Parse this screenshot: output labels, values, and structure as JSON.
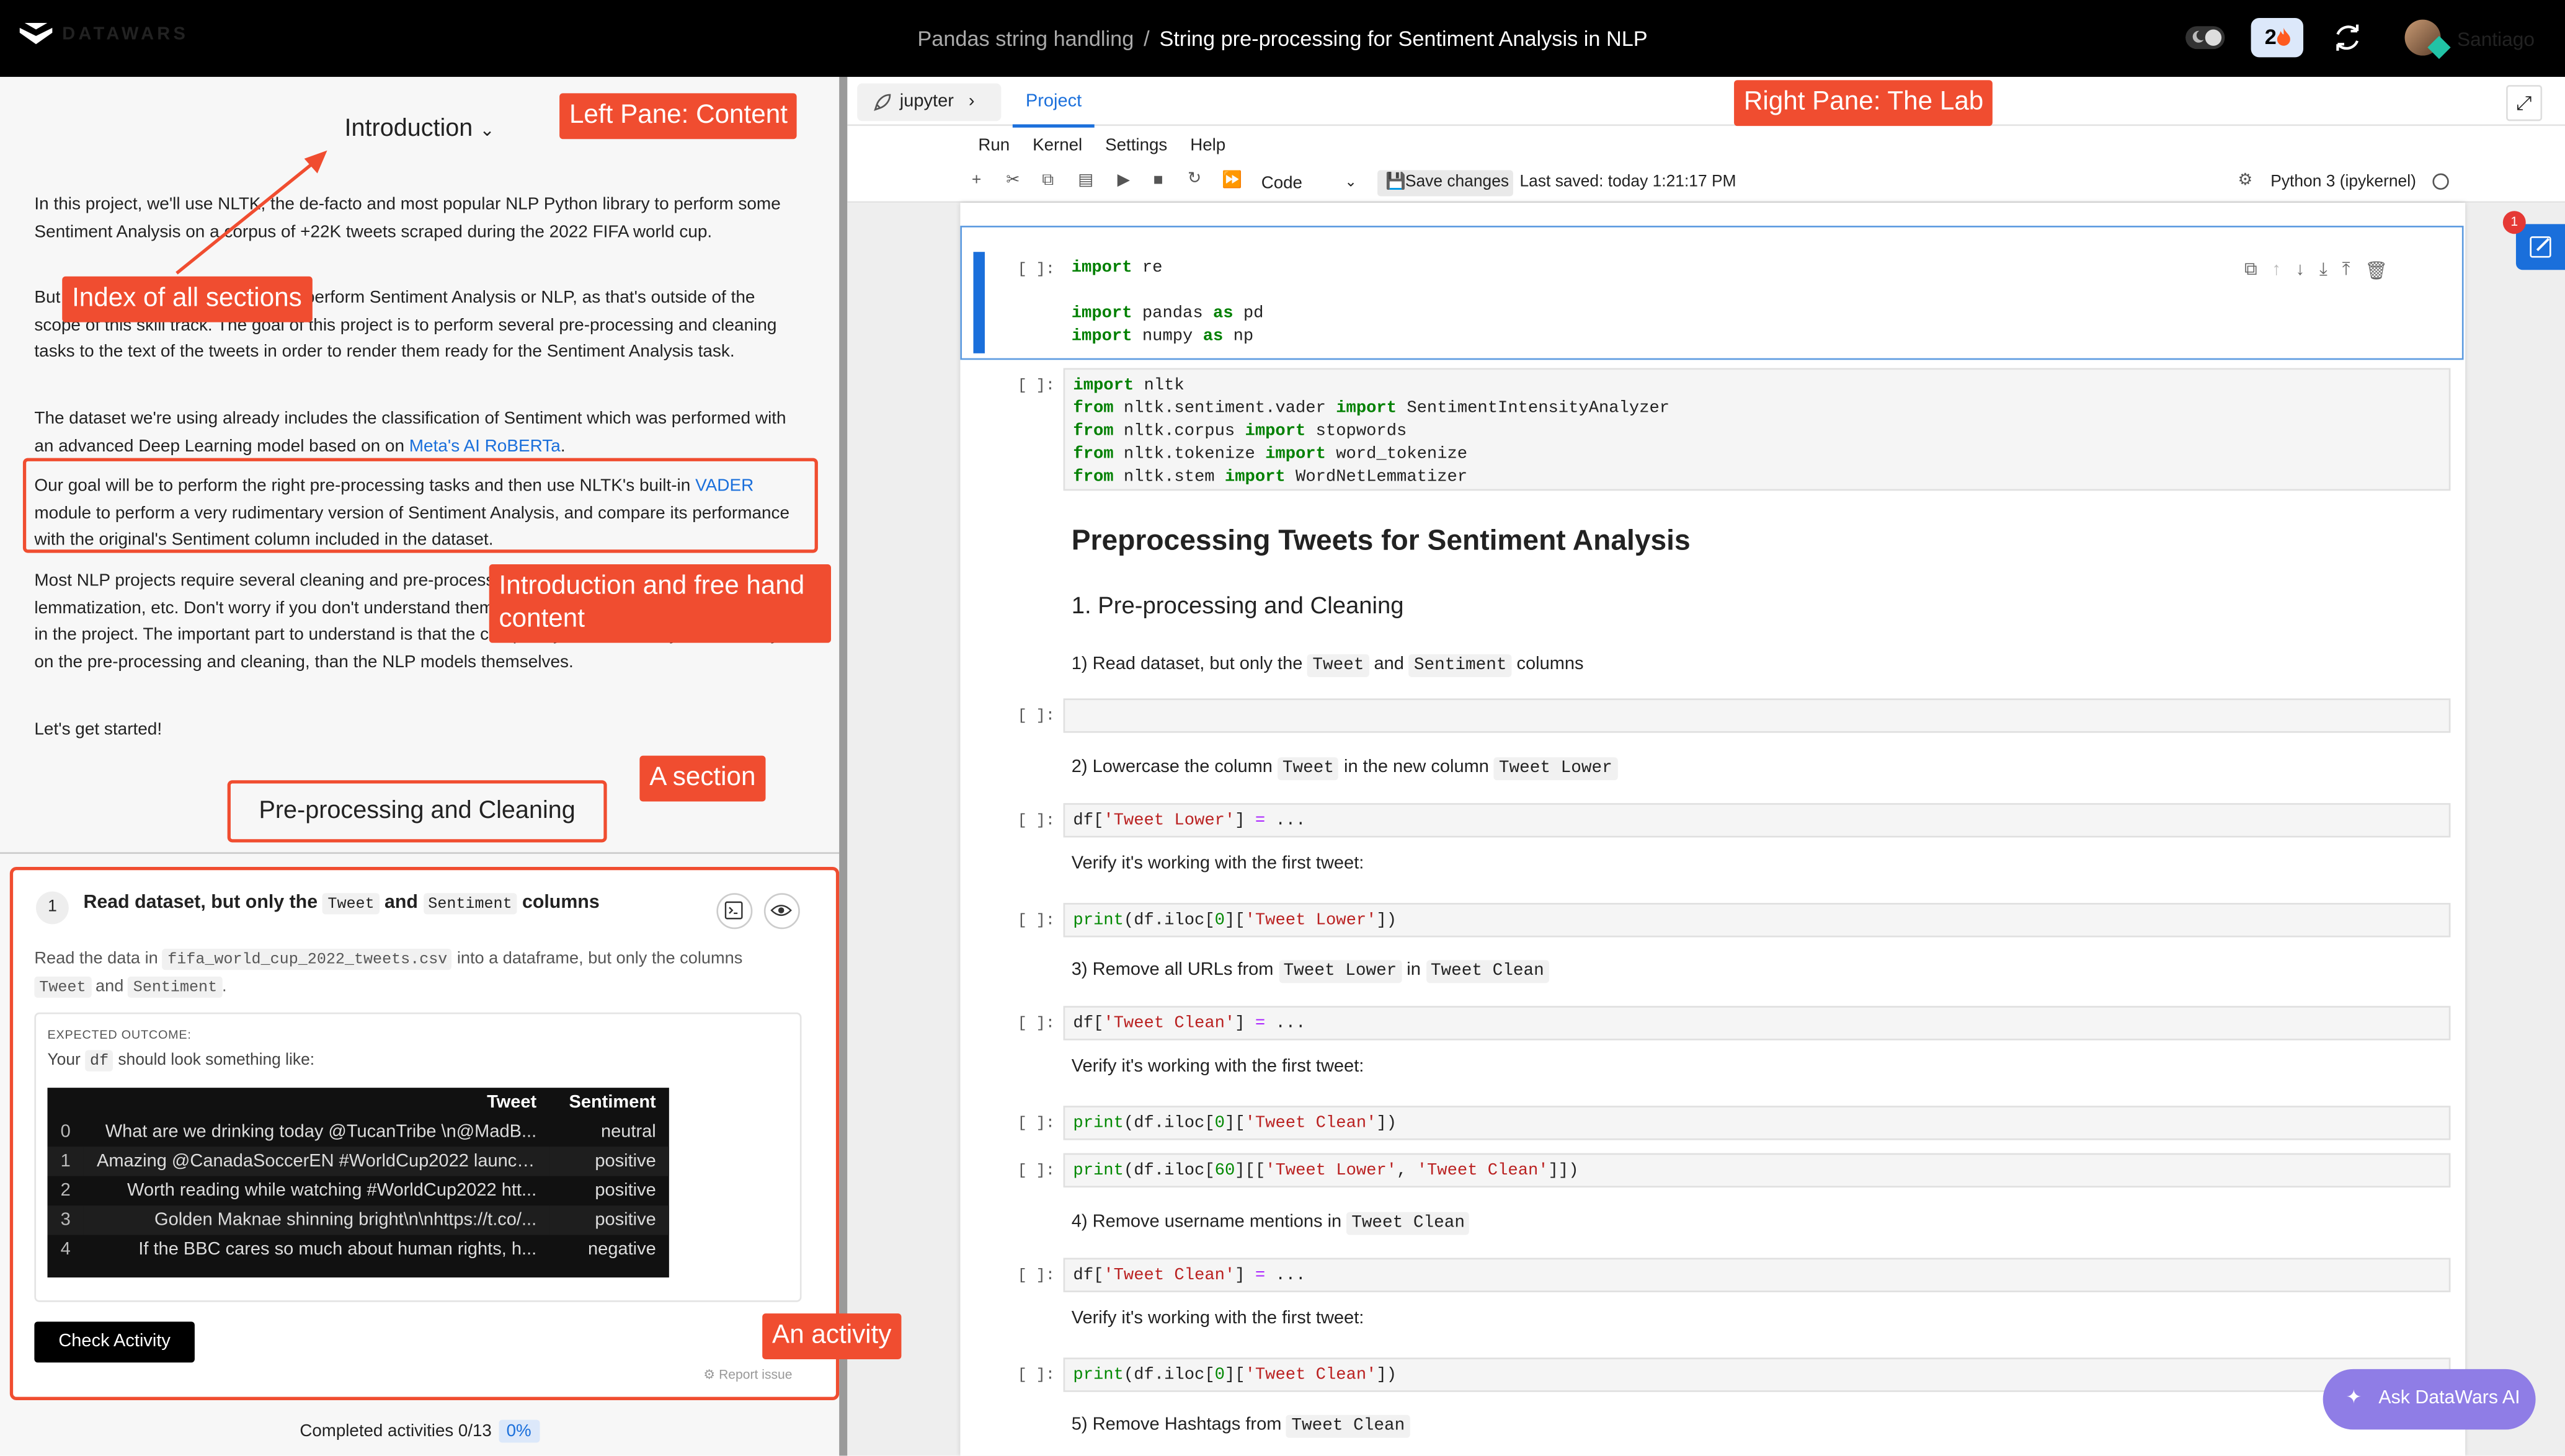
{
  "topbar": {
    "brand": "DATAWARS",
    "breadcrumb_parent": "Pandas string handling",
    "breadcrumb_sep": "/",
    "breadcrumb_current": "String pre-processing for Sentiment Analysis in NLP",
    "streak_count": "2",
    "streak_icon": "flame-icon",
    "user_name": "Santiago"
  },
  "left": {
    "intro_title": "Introduction",
    "p1": "In this project, we'll use NLTK, the de-facto and most popular NLP Python library to perform some Sentiment Analysis on a corpus of +22K tweets scraped during the 2022 FIFA world cup.",
    "p2": "But the goal of this project is not to perform Sentiment Analysis or NLP, as that's outside of the scope of this skill track. The goal of this project is to perform several pre-processing and cleaning tasks to the text of the tweets in order to render them ready for the Sentiment Analysis task.",
    "p3_text": "The dataset we're using already includes the classification of Sentiment which was performed with an advanced Deep Learning model based on on ",
    "p3_link": "Meta's AI RoBERTa",
    "p3_end": ".",
    "p4_a": "Our goal will be to perform the right pre-processing tasks and then use NLTK's built-in ",
    "p4_link": "VADER",
    "p4_b": " module to perform a very rudimentary version of Sentiment Analysis, and compare its performance with the original's Sentiment column included in the dataset.",
    "p5": "Most NLP projects require several cleaning and pre-processing tasks: tokenization, stemming, lemmatization, etc. Don't worry if you don't understand them, we'll explain them as they're required in the project. The important part to understand is that the complexity of NLP usually relies mostly on the pre-processing and cleaning, than the NLP models themselves.",
    "p6": "Let's get started!",
    "section_title": "Pre-processing and Cleaning",
    "activity": {
      "number": "1",
      "title_a": "Read dataset, but only the ",
      "title_c1": "Tweet",
      "title_b": " and ",
      "title_c2": "Sentiment",
      "title_d": " columns",
      "desc_a": "Read the data in ",
      "desc_file": "fifa_world_cup_2022_tweets.csv",
      "desc_b": " into a dataframe, but only the columns ",
      "desc_c1": "Tweet",
      "desc_and": " and ",
      "desc_c2": "Sentiment",
      "desc_end": ".",
      "expected_label": "EXPECTED OUTCOME:",
      "look_a": "Your ",
      "look_code": "df",
      "look_b": " should look something like:",
      "table_headers": [
        "Tweet",
        "Sentiment"
      ],
      "rows": [
        {
          "idx": "0",
          "tweet": "What are we drinking today @TucanTribe \\n@MadB...",
          "sentiment": "neutral"
        },
        {
          "idx": "1",
          "tweet": "Amazing @CanadaSoccerEN #WorldCup2022 launch ...",
          "sentiment": "positive"
        },
        {
          "idx": "2",
          "tweet": "Worth reading while watching #WorldCup2022 htt...",
          "sentiment": "positive"
        },
        {
          "idx": "3",
          "tweet": "Golden Maknae shinning bright\\n\\nhttps://t.co/...",
          "sentiment": "positive"
        },
        {
          "idx": "4",
          "tweet": "If the BBC cares so much about human rights, h...",
          "sentiment": "negative"
        }
      ],
      "check_button": "Check Activity",
      "report": "Report issue"
    },
    "completed_label": "Completed activities 0/13",
    "completed_pct": "0%"
  },
  "annotations": {
    "left_pane": "Left Pane: Content",
    "index": "Index of all sections",
    "intro": "Introduction and free hand content",
    "section": "A section",
    "activity": "An activity",
    "right_pane": "Right Pane: The Lab"
  },
  "lab": {
    "tab_jupyter": "jupyter",
    "tab_project": "Project",
    "menu": [
      "Run",
      "Kernel",
      "Settings",
      "Help"
    ],
    "cell_type": "Code",
    "save_button": "Save changes",
    "last_saved": "Last saved: today 1:21:17 PM",
    "kernel": "Python 3 (ipykernel)",
    "prompt": "[ ]:",
    "md_h1": "Preprocessing Tweets for Sentiment Analysis",
    "md_h2": "1. Pre-processing and Cleaning",
    "md1_a": "1) Read dataset, but only the ",
    "md1_c1": "Tweet",
    "md1_and": " and ",
    "md1_c2": "Sentiment",
    "md1_b": " columns",
    "md2_a": "2) Lowercase the column ",
    "md2_c1": "Tweet",
    "md2_b": " in the new column ",
    "md2_c2": "Tweet Lower",
    "verify": "Verify it's working with the first tweet:",
    "md3_a": "3) Remove all URLs from ",
    "md3_c1": "Tweet Lower",
    "md3_in": " in ",
    "md3_c2": "Tweet Clean",
    "md4_a": "4) Remove username mentions in ",
    "md4_c1": "Tweet Clean",
    "md5_a": "5) Remove Hashtags from ",
    "md5_c1": "Tweet Clean",
    "ask_ai": "Ask DataWars AI",
    "notif_count": "1"
  }
}
